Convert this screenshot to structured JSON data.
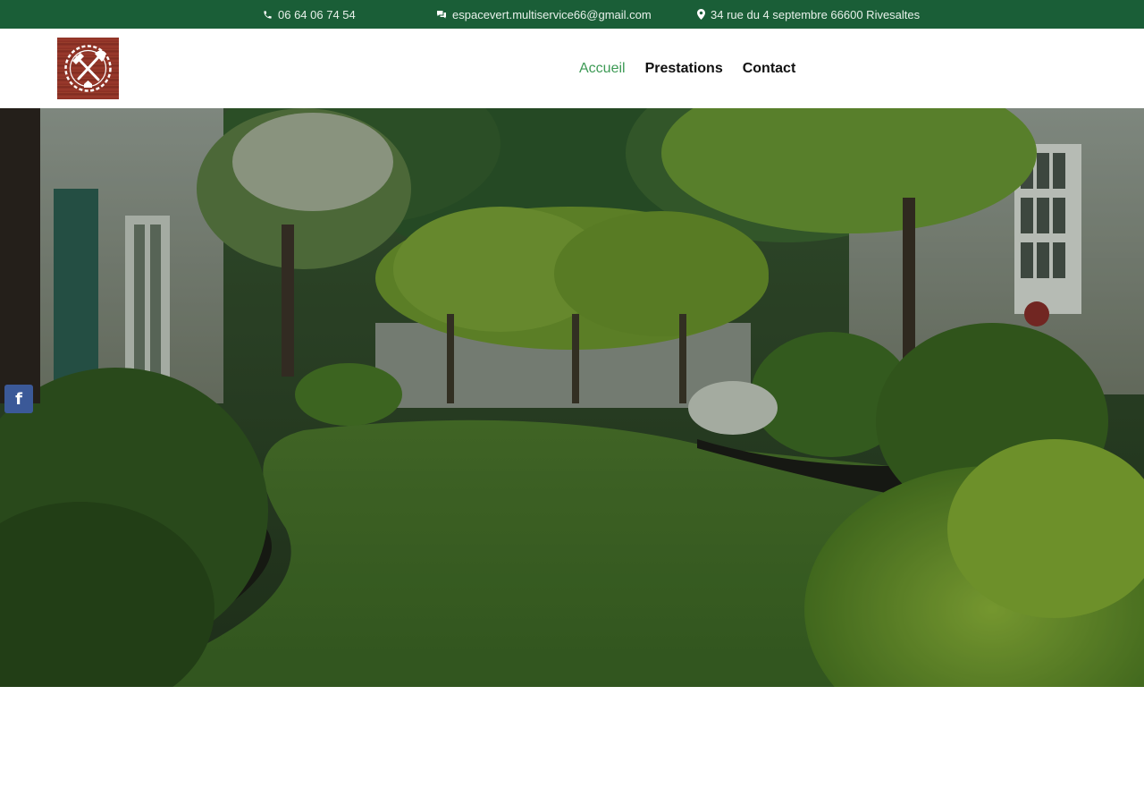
{
  "topbar": {
    "phone": "06 64 06 74 54",
    "email": "espacevert.multiservice66@gmail.com",
    "address": "34 rue du 4 septembre 66600 Rivesaltes",
    "phone_icon": "phone-icon",
    "email_icon": "chat-bubbles-icon",
    "address_icon": "map-pin-icon"
  },
  "header": {
    "logo_icon": "tools-badge-logo"
  },
  "nav": {
    "items": [
      {
        "label": "Accueil",
        "active": true
      },
      {
        "label": "Prestations",
        "active": false
      },
      {
        "label": "Contact",
        "active": false
      }
    ]
  },
  "hero": {
    "image": "garden-lawn-photo"
  },
  "social": {
    "facebook_glyph": "f",
    "facebook_icon": "facebook-icon"
  },
  "colors": {
    "topbar_bg": "#1a5e37",
    "nav_active": "#3d9a55",
    "facebook": "#3b5998"
  }
}
